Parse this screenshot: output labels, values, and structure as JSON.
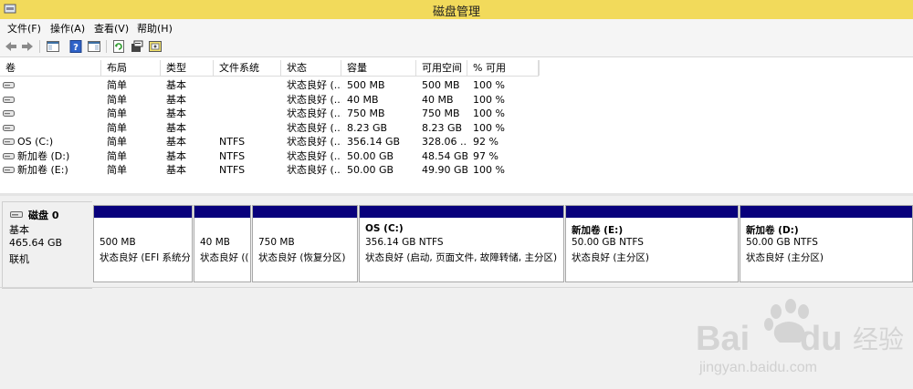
{
  "window": {
    "title": "磁盘管理",
    "icon": "disk-management-icon"
  },
  "menu": [
    "文件(F)",
    "操作(A)",
    "查看(V)",
    "帮助(H)"
  ],
  "toolbar": [
    "back-icon",
    "forward-icon",
    "console-tree-icon",
    "help-icon",
    "show-hide-icon",
    "refresh-icon",
    "properties-icon",
    "help-topics-icon"
  ],
  "volume_list": {
    "columns": [
      "卷",
      "布局",
      "类型",
      "文件系统",
      "状态",
      "容量",
      "可用空间",
      "% 可用"
    ],
    "rows": [
      {
        "vol": "",
        "layout": "简单",
        "type": "基本",
        "fs": "",
        "status": "状态良好 (...",
        "capacity": "500 MB",
        "free": "500 MB",
        "pct": "100 %"
      },
      {
        "vol": "",
        "layout": "简单",
        "type": "基本",
        "fs": "",
        "status": "状态良好 (...",
        "capacity": "40 MB",
        "free": "40 MB",
        "pct": "100 %"
      },
      {
        "vol": "",
        "layout": "简单",
        "type": "基本",
        "fs": "",
        "status": "状态良好 (...",
        "capacity": "750 MB",
        "free": "750 MB",
        "pct": "100 %"
      },
      {
        "vol": "",
        "layout": "简单",
        "type": "基本",
        "fs": "",
        "status": "状态良好 (...",
        "capacity": "8.23 GB",
        "free": "8.23 GB",
        "pct": "100 %"
      },
      {
        "vol": "OS (C:)",
        "layout": "简单",
        "type": "基本",
        "fs": "NTFS",
        "status": "状态良好 (...",
        "capacity": "356.14 GB",
        "free": "328.06 ...",
        "pct": "92 %"
      },
      {
        "vol": "新加卷 (D:)",
        "layout": "简单",
        "type": "基本",
        "fs": "NTFS",
        "status": "状态良好 (...",
        "capacity": "50.00 GB",
        "free": "48.54 GB",
        "pct": "97 %"
      },
      {
        "vol": "新加卷 (E:)",
        "layout": "简单",
        "type": "基本",
        "fs": "NTFS",
        "status": "状态良好 (...",
        "capacity": "50.00 GB",
        "free": "49.90 GB",
        "pct": "100 %"
      }
    ]
  },
  "disk": {
    "name": "磁盘 0",
    "type": "基本",
    "size": "465.64 GB",
    "state": "联机"
  },
  "partitions": [
    {
      "title": "",
      "size": "500 MB",
      "status": "状态良好 (EFI 系统分"
    },
    {
      "title": "",
      "size": "40 MB",
      "status": "状态良好 (("
    },
    {
      "title": "",
      "size": "750 MB",
      "status": "状态良好 (恢复分区)"
    },
    {
      "title": "OS  (C:)",
      "size": "356.14 GB NTFS",
      "status": "状态良好 (启动, 页面文件, 故障转储, 主分区)"
    },
    {
      "title": "新加卷  (E:)",
      "size": "50.00 GB NTFS",
      "status": "状态良好 (主分区)"
    },
    {
      "title": "新加卷  (D:)",
      "size": "50.00 GB NTFS",
      "status": "状态良好 (主分区)"
    }
  ],
  "watermark": {
    "brand": "Bai",
    "brand2": "du",
    "cn": "经验",
    "url": "jingyan.baidu.com"
  },
  "colors": {
    "titlebar": "#f2da5b",
    "partition_bar": "#08007c"
  }
}
